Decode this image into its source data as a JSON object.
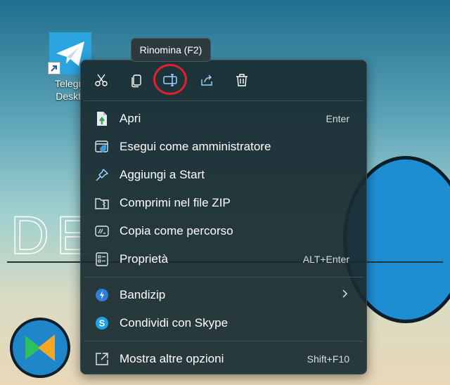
{
  "desktop": {
    "background_text": "DE",
    "telegram_icon": {
      "label_line1": "Telegra",
      "label_line2": "Deskto"
    }
  },
  "tooltip": {
    "text": "Rinomina (F2)"
  },
  "toolbar": {
    "buttons": [
      {
        "name": "cut",
        "icon": "scissors-icon"
      },
      {
        "name": "copy",
        "icon": "copy-icon"
      },
      {
        "name": "rename",
        "icon": "rename-icon",
        "highlighted": true
      },
      {
        "name": "share",
        "icon": "share-icon"
      },
      {
        "name": "delete",
        "icon": "trash-icon"
      }
    ]
  },
  "menu": {
    "items": [
      {
        "label": "Apri",
        "shortcut": "Enter",
        "icon": "open-file-icon"
      },
      {
        "label": "Esegui come amministratore",
        "shortcut": "",
        "icon": "shield-window-icon"
      },
      {
        "label": "Aggiungi a Start",
        "shortcut": "",
        "icon": "pin-icon"
      },
      {
        "label": "Comprimi nel file ZIP",
        "shortcut": "",
        "icon": "zip-folder-icon"
      },
      {
        "label": "Copia come percorso",
        "shortcut": "",
        "icon": "copy-path-icon"
      },
      {
        "label": "Proprietà",
        "shortcut": "ALT+Enter",
        "icon": "properties-icon"
      },
      {
        "label": "Bandizip",
        "shortcut": "",
        "icon": "bandizip-icon",
        "submenu": true
      },
      {
        "label": "Condividi con Skype",
        "shortcut": "",
        "icon": "skype-icon"
      },
      {
        "label": "Mostra altre opzioni",
        "shortcut": "Shift+F10",
        "icon": "more-options-icon"
      }
    ]
  },
  "colors": {
    "menu_bg": "#1a2c32",
    "accent": "#1e8ed2",
    "highlight_ring": "#e3202a"
  }
}
